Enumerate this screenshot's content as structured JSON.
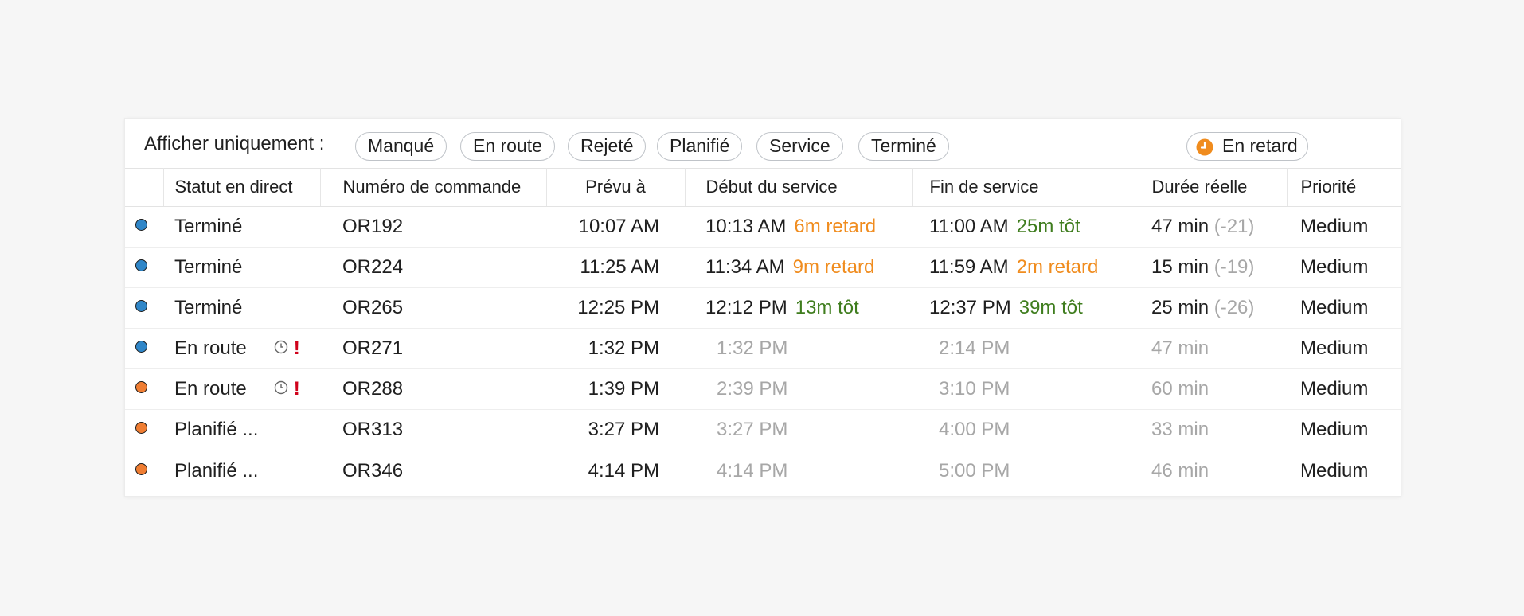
{
  "colors": {
    "late": "#f08c1e",
    "early": "#3f7d1e",
    "muted": "#a7a7a7",
    "dot_blue": "#2f86c8",
    "dot_orange": "#ef7d32",
    "alert": "#d0021b"
  },
  "filters": {
    "label": "Afficher uniquement :",
    "pills": [
      "Manqué",
      "En route",
      "Rejeté",
      "Planifié",
      "Service",
      "Terminé"
    ],
    "late_pill": {
      "label": "En retard",
      "icon": "clock-icon"
    }
  },
  "table": {
    "headers": [
      "Statut en direct",
      "Numéro de commande",
      "Prévu à",
      "Début du service",
      "Fin de service",
      "Durée réelle",
      "Priorité"
    ],
    "rows": [
      {
        "dot_color": "#2f86c8",
        "status": "Terminé",
        "icons": false,
        "order": "OR192",
        "scheduled": "10:07 AM",
        "start": "10:13 AM",
        "start_diff": "6m retard",
        "start_diff_color": "#f08c1e",
        "start_muted": false,
        "end": "11:00 AM",
        "end_diff": "25m tôt",
        "end_diff_color": "#3f7d1e",
        "end_muted": false,
        "duration": "47 min",
        "duration_diff": "(-21)",
        "duration_muted": false,
        "priority": "Medium"
      },
      {
        "dot_color": "#2f86c8",
        "status": "Terminé",
        "icons": false,
        "order": "OR224",
        "scheduled": "11:25 AM",
        "start": "11:34 AM",
        "start_diff": "9m retard",
        "start_diff_color": "#f08c1e",
        "start_muted": false,
        "end": "11:59 AM",
        "end_diff": "2m retard",
        "end_diff_color": "#f08c1e",
        "end_muted": false,
        "duration": "15 min",
        "duration_diff": "(-19)",
        "duration_muted": false,
        "priority": "Medium"
      },
      {
        "dot_color": "#2f86c8",
        "status": "Terminé",
        "icons": false,
        "order": "OR265",
        "scheduled": "12:25 PM",
        "start": "12:12 PM",
        "start_diff": "13m tôt",
        "start_diff_color": "#3f7d1e",
        "start_muted": false,
        "end": "12:37 PM",
        "end_diff": "39m tôt",
        "end_diff_color": "#3f7d1e",
        "end_muted": false,
        "duration": "25 min",
        "duration_diff": "(-26)",
        "duration_muted": false,
        "priority": "Medium"
      },
      {
        "dot_color": "#2f86c8",
        "status": "En route",
        "icons": true,
        "order": "OR271",
        "scheduled": "1:32 PM",
        "start": "1:32 PM",
        "start_diff": "",
        "start_diff_color": "",
        "start_muted": true,
        "end": "2:14 PM",
        "end_diff": "",
        "end_diff_color": "",
        "end_muted": true,
        "duration": "47 min",
        "duration_diff": "",
        "duration_muted": true,
        "priority": "Medium"
      },
      {
        "dot_color": "#ef7d32",
        "status": "En route",
        "icons": true,
        "order": "OR288",
        "scheduled": "1:39 PM",
        "start": "2:39 PM",
        "start_diff": "",
        "start_diff_color": "",
        "start_muted": true,
        "end": "3:10 PM",
        "end_diff": "",
        "end_diff_color": "",
        "end_muted": true,
        "duration": "60 min",
        "duration_diff": "",
        "duration_muted": true,
        "priority": "Medium"
      },
      {
        "dot_color": "#ef7d32",
        "status": "Planifié ...",
        "icons": false,
        "order": "OR313",
        "scheduled": "3:27 PM",
        "start": "3:27 PM",
        "start_diff": "",
        "start_diff_color": "",
        "start_muted": true,
        "end": "4:00 PM",
        "end_diff": "",
        "end_diff_color": "",
        "end_muted": true,
        "duration": "33 min",
        "duration_diff": "",
        "duration_muted": true,
        "priority": "Medium"
      },
      {
        "dot_color": "#ef7d32",
        "status": "Planifié ...",
        "icons": false,
        "order": "OR346",
        "scheduled": "4:14 PM",
        "start": "4:14 PM",
        "start_diff": "",
        "start_diff_color": "",
        "start_muted": true,
        "end": "5:00 PM",
        "end_diff": "",
        "end_diff_color": "",
        "end_muted": true,
        "duration": "46 min",
        "duration_diff": "",
        "duration_muted": true,
        "priority": "Medium"
      }
    ]
  }
}
